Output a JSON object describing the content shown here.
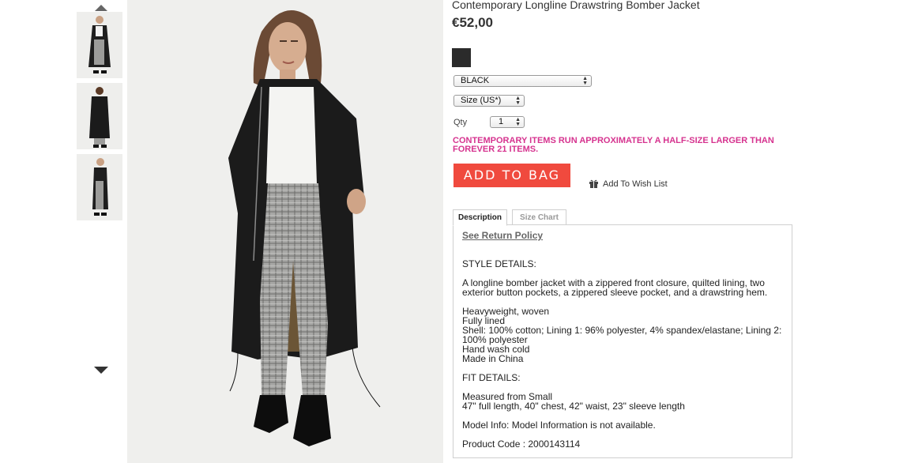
{
  "gallery": {
    "up_icon": "triangle-up",
    "down_icon": "triangle-down",
    "thumbnail_count": 3
  },
  "product": {
    "title": "Contemporary Longline Drawstring Bomber Jacket",
    "price": "€52,00",
    "swatch_color": "#2b2b2b",
    "color_select": "BLACK",
    "size_select": "Size (US*)",
    "qty_label": "Qty",
    "qty_value": "1",
    "notice": "CONTEMPORARY ITEMS RUN APPROXIMATELY A HALF-SIZE LARGER THAN FOREVER 21 ITEMS.",
    "add_to_bag": "ADD TO BAG",
    "wish_list": "Add To Wish List"
  },
  "tabs": {
    "description": "Description",
    "size_chart": "Size Chart"
  },
  "description": {
    "return_policy": "See Return Policy",
    "style_heading": "STYLE DETAILS:",
    "style_text": "A longline bomber jacket with a zippered front closure, quilted lining, two exterior button pockets, a zippered sleeve pocket, and a drawstring hem.",
    "materials": [
      "Heavyweight, woven",
      "Fully lined",
      "Shell: 100% cotton; Lining 1: 96% polyester, 4% spandex/elastane; Lining 2: 100% polyester",
      "Hand wash cold",
      "Made in China"
    ],
    "fit_heading": "FIT DETAILS:",
    "fit_lines": [
      "Measured from Small",
      "47\" full length, 40\" chest, 42\" waist, 23\" sleeve length"
    ],
    "model_info": "Model Info:  Model Information is not available.",
    "product_code": "Product Code : 2000143114"
  },
  "colors": {
    "accent_button": "#f04a3e",
    "notice_text": "#d6338f"
  }
}
